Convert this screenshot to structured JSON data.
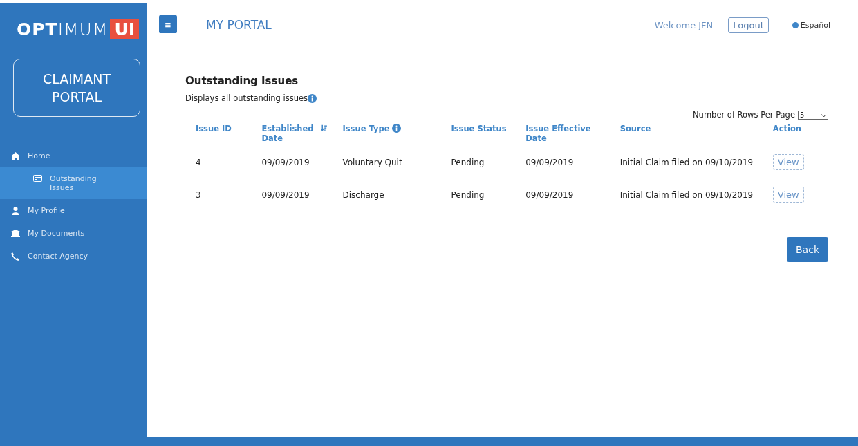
{
  "logo": {
    "name": "**OPT**IMUM",
    "badge": "UI"
  },
  "portal_box": {
    "line_1": "CLAIMANT",
    "line_2": "PORTAL"
  },
  "sidebar": {
    "items": [
      {
        "label": "Home",
        "selected": false,
        "children": [
          {
            "label": "Outstanding Issues",
            "selected": true
          }
        ]
      },
      {
        "label": "My Profile",
        "selected": false
      },
      {
        "label": "My Documents",
        "selected": false
      },
      {
        "label": "Contact Agency",
        "selected": false
      }
    ]
  },
  "header": {
    "menu_button": "≡",
    "title": "MY PORTAL",
    "welcome": "Welcome JFN",
    "logout": "Logout",
    "language": "Español"
  },
  "panel": {
    "title": "Outstanding Issues",
    "subtitle": "Displays all outstanding issues",
    "rows_per_page_label": "Number of Rows Per Page",
    "rows_per_page": "5",
    "back": "Back"
  },
  "table": {
    "columns": [
      {
        "label": "Issue ID"
      },
      {
        "label": "Established Date"
      },
      {
        "label": "Issue Type"
      },
      {
        "label": "Issue Status"
      },
      {
        "label": "Issue Effective Date"
      },
      {
        "label": "Source"
      },
      {
        "label": "Action"
      }
    ],
    "rows": [
      {
        "cells": [
          "4",
          "09/09/2019",
          "Voluntary Quit",
          "Pending",
          "09/09/2019",
          "Initial Claim filed on 09/10/2019"
        ],
        "action": "View"
      },
      {
        "cells": [
          "3",
          "09/09/2019",
          "Discharge",
          "Pending",
          "09/09/2019",
          "Initial Claim filed on 09/10/2019"
        ],
        "action": "View"
      }
    ]
  }
}
